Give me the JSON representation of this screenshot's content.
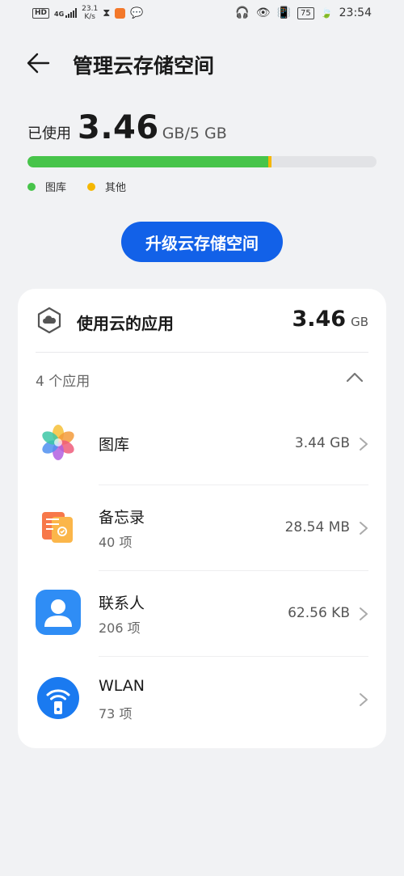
{
  "status_bar": {
    "hd": "HD",
    "network": "4G",
    "speed": "23.1\nK/s",
    "time": "23:54",
    "battery": "75"
  },
  "header": {
    "title": "管理云存储空间"
  },
  "usage": {
    "label": "已使用",
    "value": "3.46",
    "unit": "GB",
    "separator": "/",
    "total": "5 GB",
    "used_fraction": 0.693,
    "legend": [
      {
        "label": "图库",
        "color": "#47c44a"
      },
      {
        "label": "其他",
        "color": "#f5b700"
      }
    ]
  },
  "upgrade_label": "升级云存储空间",
  "card": {
    "title": "使用云的应用",
    "size_value": "3.46",
    "size_unit": "GB",
    "apps_count": "4 个应用",
    "apps": [
      {
        "name": "图库",
        "sub": "",
        "size": "3.44 GB",
        "icon": "gallery-icon"
      },
      {
        "name": "备忘录",
        "sub": "40 项",
        "size": "28.54 MB",
        "icon": "notes-icon"
      },
      {
        "name": "联系人",
        "sub": "206 项",
        "size": "62.56 KB",
        "icon": "contacts-icon"
      },
      {
        "name": "WLAN",
        "sub": "73 项",
        "size": "",
        "icon": "wlan-icon"
      }
    ]
  },
  "colors": {
    "accent": "#1261e8",
    "gallery": "#47c44a",
    "other": "#f5b700"
  }
}
